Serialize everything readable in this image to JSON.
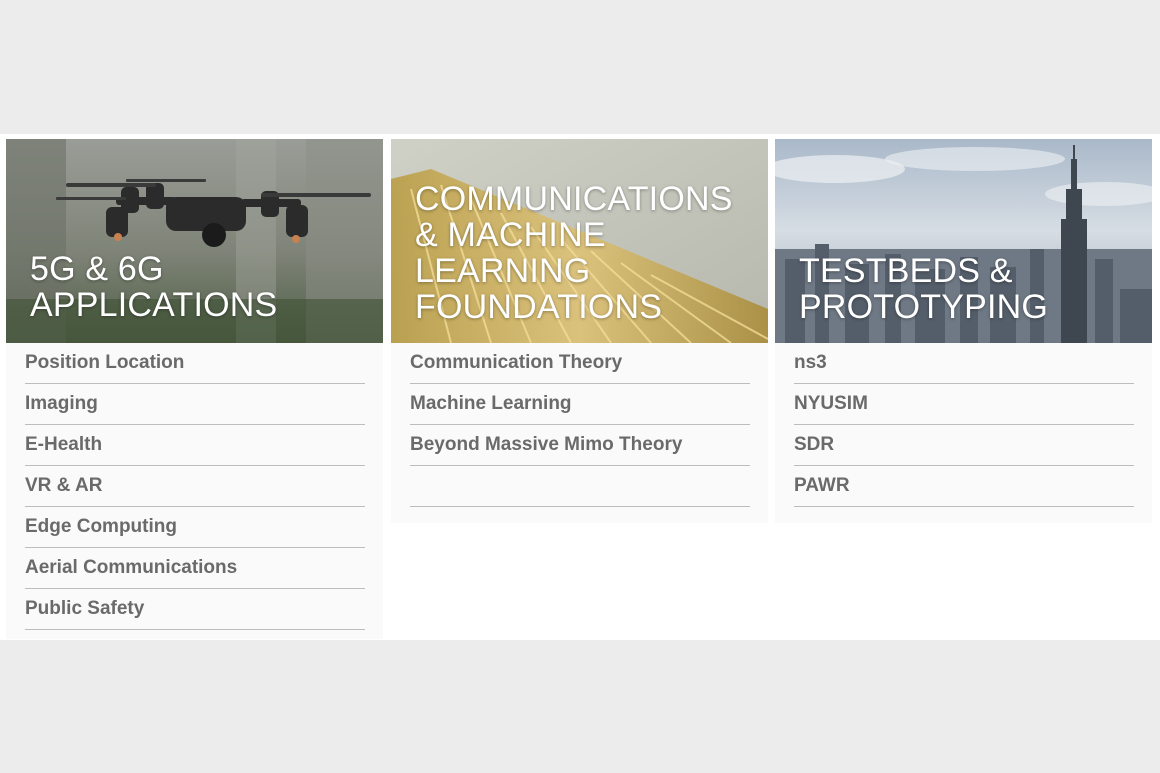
{
  "colors": {
    "page_background": "#ececec",
    "band_background": "#ffffff",
    "card_background": "#fafafa",
    "topic_text": "#6a6a6a",
    "divider": "#bdbdbd",
    "hero_text": "#ffffff"
  },
  "cards": [
    {
      "title": "5G & 6G APPLICATIONS",
      "image": "drone-photo",
      "topics": [
        "Position Location",
        "Imaging",
        "E-Health",
        "VR & AR",
        "Edge Computing",
        "Aerial Communications",
        "Public Safety"
      ]
    },
    {
      "title": "COMMUNICATIONS & MACHINE LEARNING FOUNDATIONS",
      "image": "circuit-pins-photo",
      "topics": [
        "Communication Theory",
        "Machine Learning",
        "Beyond Massive Mimo Theory",
        ""
      ]
    },
    {
      "title": "TESTBEDS & PROTOTYPING",
      "image": "city-skyline-photo",
      "topics": [
        "ns3",
        "NYUSIM",
        "SDR",
        "PAWR"
      ]
    }
  ]
}
